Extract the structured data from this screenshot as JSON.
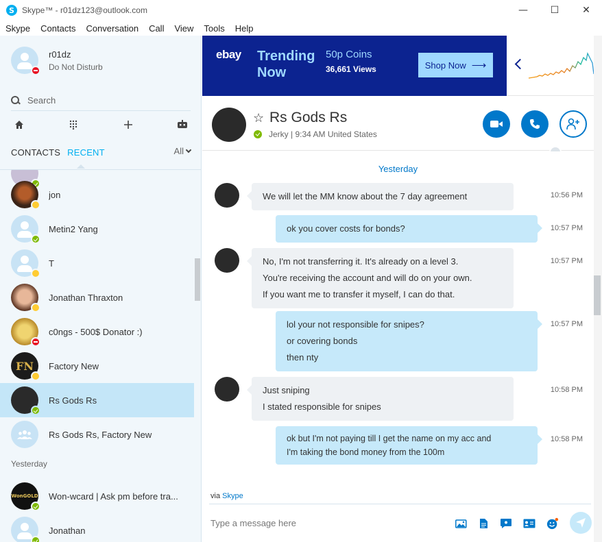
{
  "window": {
    "title": "Skype™ - r01dz123@outlook.com",
    "controls": {
      "minimize": "—",
      "maximize": "☐",
      "close": "✕"
    }
  },
  "menu": [
    "Skype",
    "Contacts",
    "Conversation",
    "Call",
    "View",
    "Tools",
    "Help"
  ],
  "profile": {
    "name": "r01dz",
    "status": "Do Not Disturb",
    "presence": "dnd"
  },
  "search": {
    "placeholder": "Search"
  },
  "toolbar": {
    "home_icon": "home-icon",
    "dialpad_icon": "dialpad-icon",
    "add_icon": "plus-icon",
    "bot_icon": "bot-icon"
  },
  "tabs": {
    "contacts": "CONTACTS",
    "recent": "RECENT",
    "filter": "All"
  },
  "contacts": [
    {
      "name": "jon",
      "avatar": "photo",
      "presence": "away"
    },
    {
      "name": "Metin2 Yang",
      "avatar": "default",
      "presence": "online"
    },
    {
      "name": "T",
      "avatar": "default",
      "presence": "away"
    },
    {
      "name": "Jonathan Thraxton",
      "avatar": "photo",
      "presence": "away"
    },
    {
      "name": "c0ngs - 500$ Donator :)",
      "avatar": "photo",
      "presence": "dnd"
    },
    {
      "name": "Factory New",
      "avatar": "photo",
      "initials": "FN",
      "presence": "away"
    },
    {
      "name": "Rs Gods Rs",
      "avatar": "dark",
      "presence": "online",
      "selected": true
    },
    {
      "name": "Rs Gods Rs, Factory New",
      "avatar": "group",
      "presence": ""
    }
  ],
  "section_yesterday": "Yesterday",
  "contacts_yesterday": [
    {
      "name": "Won-wcard | Ask pm before tra...",
      "avatar": "photo",
      "initials": "WonGOLD",
      "presence": "online"
    },
    {
      "name": "Jonathan",
      "avatar": "default",
      "presence": "online"
    }
  ],
  "ad": {
    "brand": "ebay",
    "headline": "Trending Now",
    "item": "50p Coins",
    "views": "36,661 Views",
    "cta": "Shop Now",
    "accent": "#0c2390"
  },
  "conversation": {
    "name": "Rs Gods Rs",
    "subtitle": "Jerky | 9:34 AM United States",
    "day_label": "Yesterday",
    "messages": [
      {
        "dir": "in",
        "lines": [
          "We will let the MM know about the 7 day agreement"
        ],
        "time": "10:56 PM"
      },
      {
        "dir": "out",
        "lines": [
          "ok you cover costs for bonds?"
        ],
        "time": "10:57 PM"
      },
      {
        "dir": "in",
        "lines": [
          "No, I'm not transferring it. It's already on a level 3.",
          "You're receiving the account and will do on your own.",
          "If you want me to transfer it myself, I can do that."
        ],
        "time": "10:57 PM"
      },
      {
        "dir": "out",
        "lines": [
          "lol your not responsible for snipes?",
          "or covering bonds",
          "then nty"
        ],
        "time": "10:57 PM"
      },
      {
        "dir": "in",
        "lines": [
          "Just sniping",
          "I stated responsible for snipes"
        ],
        "time": "10:58 PM"
      },
      {
        "dir": "out",
        "lines": [
          "ok but I'm not paying till I get the name on my acc and",
          "I'm taking the bond money from the 100m"
        ],
        "time": "10:58 PM"
      }
    ]
  },
  "composer": {
    "via": "via",
    "via_link": "Skype",
    "placeholder": "Type a message here"
  },
  "colors": {
    "skype_blue": "#00aff0",
    "action_blue": "#0078ca",
    "online": "#7fba00",
    "away": "#ffcc33",
    "dnd": "#e81123"
  }
}
